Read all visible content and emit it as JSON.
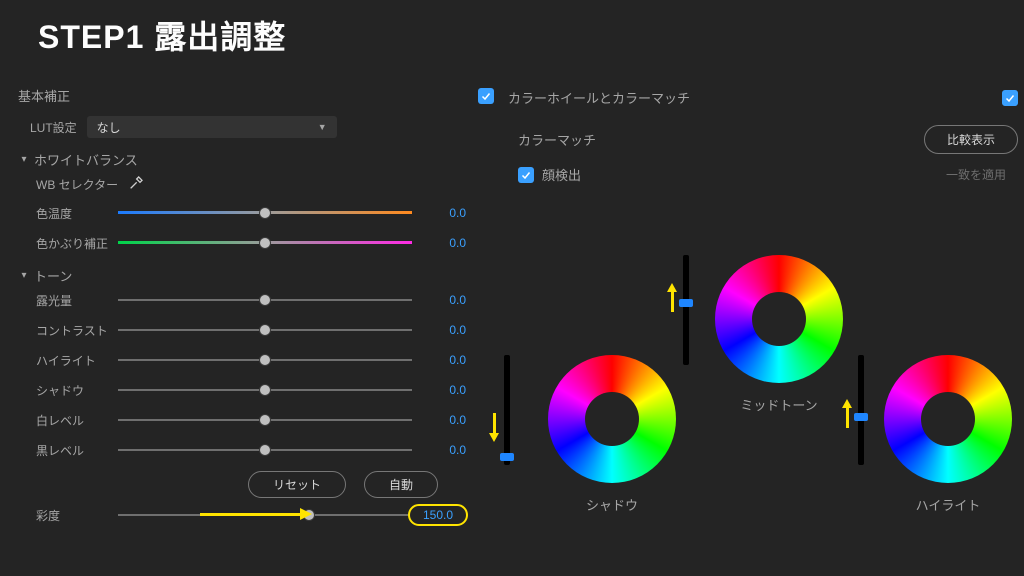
{
  "title": "STEP1 露出調整",
  "left": {
    "basic": "基本補正",
    "lut_label": "LUT設定",
    "lut_value": "なし",
    "wb_section": "ホワイトバランス",
    "wb_selector": "WB セレクター",
    "temp": {
      "label": "色温度",
      "value": "0.0",
      "pos": 50
    },
    "tint": {
      "label": "色かぶり補正",
      "value": "0.0",
      "pos": 50
    },
    "tone_section": "トーン",
    "tone": [
      {
        "label": "露光量",
        "value": "0.0",
        "pos": 50
      },
      {
        "label": "コントラスト",
        "value": "0.0",
        "pos": 50
      },
      {
        "label": "ハイライト",
        "value": "0.0",
        "pos": 50
      },
      {
        "label": "シャドウ",
        "value": "0.0",
        "pos": 50
      },
      {
        "label": "白レベル",
        "value": "0.0",
        "pos": 50
      },
      {
        "label": "黒レベル",
        "value": "0.0",
        "pos": 50
      }
    ],
    "reset": "リセット",
    "auto": "自動",
    "sat": {
      "label": "彩度",
      "value": "150.0",
      "pos": 66
    }
  },
  "right": {
    "title": "カラーホイールとカラーマッチ",
    "match": "カラーマッチ",
    "compare": "比較表示",
    "apply": "一致を適用",
    "face": "顔検出",
    "wheels": {
      "shadow": "シャドウ",
      "mid": "ミッドトーン",
      "hi": "ハイライト"
    }
  }
}
